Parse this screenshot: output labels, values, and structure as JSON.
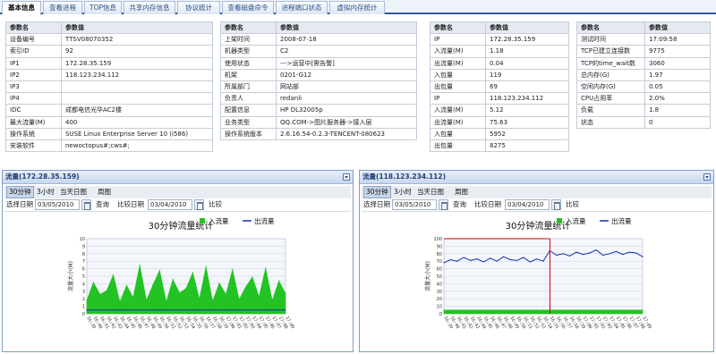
{
  "tabs": [
    {
      "label": "基本信息",
      "active": true
    },
    {
      "label": "查看进程"
    },
    {
      "label": "TOP信息"
    },
    {
      "label": "共享内存信息"
    },
    {
      "label": "协议统计"
    },
    {
      "label": "查看磁盘命令"
    },
    {
      "label": "进程端口状态"
    },
    {
      "label": "虚拟内存统计"
    }
  ],
  "table1": {
    "headers": [
      "参数名",
      "参数值"
    ],
    "rows": [
      [
        "设备编号",
        "TTSV08070352"
      ],
      [
        "索引ID",
        "92"
      ],
      [
        "IP1",
        "172.28.35.159"
      ],
      [
        "IP2",
        "118.123.234.112"
      ],
      [
        "IP3",
        ""
      ],
      [
        "IP4",
        ""
      ],
      [
        "IDC",
        "成都电信光华AC2楼"
      ],
      [
        "最大流量(M)",
        "400"
      ],
      [
        "操作系统",
        "SUSE Linux Enterprise Server 10 (i586)"
      ],
      [
        "安装软件",
        "newoctopus#;cws#;"
      ]
    ]
  },
  "table2": {
    "headers": [
      "参数名",
      "参数值"
    ],
    "rows": [
      [
        "上架时间",
        "2008-07-18"
      ],
      [
        "机器类型",
        "C2"
      ],
      [
        "使用状态",
        "--->运营中[需告警]"
      ],
      [
        "机架",
        "0201-G12"
      ],
      [
        "所属部门",
        "网站部"
      ],
      [
        "负责人",
        "redanli"
      ],
      [
        "配置信息",
        "HP DL32005p"
      ],
      [
        "业务类型",
        "QQ.COM->图片服务器->接入层"
      ],
      [
        "操作系统版本",
        "2.6.16.54-0.2.3-TENCENT-080623"
      ]
    ]
  },
  "table3": {
    "headers": [
      "参数名",
      "参数值"
    ],
    "rows": [
      [
        "IP",
        "172.28.35.159"
      ],
      [
        "入流量(M)",
        "1.18"
      ],
      [
        "出流量(M)",
        "0.04"
      ],
      [
        "入包量",
        "119"
      ],
      [
        "出包量",
        "69"
      ],
      [
        "IP",
        "118.123.234.112"
      ],
      [
        "入流量(M)",
        "5.12"
      ],
      [
        "出流量(M)",
        "75.63"
      ],
      [
        "入包量",
        "5952"
      ],
      [
        "出包量",
        "8275"
      ]
    ]
  },
  "table4": {
    "headers": [
      "参数名",
      "参数值"
    ],
    "rows": [
      [
        "测试时间",
        "17:09:58"
      ],
      [
        "TCP已建立连接数",
        "9775"
      ],
      [
        "TCP的time_wait数",
        "3060"
      ],
      [
        "总内存(G)",
        "1.97"
      ],
      [
        "空闲内存(G)",
        "0.05"
      ],
      [
        "CPU占用率",
        "2.0%"
      ],
      [
        "负载",
        "1.8"
      ],
      [
        "状态",
        "0"
      ]
    ]
  },
  "panels": [
    {
      "title": "流量(172.28.35.159)",
      "subtabs": [
        "30分钟",
        "3小时",
        "当天日图",
        "周图"
      ],
      "date_label": "选择日期",
      "date_value": "03/05/2010",
      "query_label": "查询",
      "compare_label": "比较日期",
      "compare_value": "03/04/2010",
      "compare_btn": "比较"
    },
    {
      "title": "流量(118.123.234.112)",
      "subtabs": [
        "30分钟",
        "3小时",
        "当天日图",
        "周图"
      ],
      "date_label": "选择日期",
      "date_value": "03/05/2010",
      "query_label": "查询",
      "compare_label": "比较日期",
      "compare_value": "03/04/2010",
      "compare_btn": "比较"
    }
  ],
  "colors": {
    "in_series": "#22c322",
    "out_series": "#1b2fa8",
    "accent": "#2c5a9b",
    "marker": "#cc0000"
  },
  "chart_data": [
    {
      "type": "area",
      "title": "30分钟流量统计",
      "ylabel": "流量大小(M)",
      "legend": [
        "入流量",
        "出流量"
      ],
      "legend_position": "top-right",
      "grid": true,
      "ylim": [
        0,
        10
      ],
      "x": [
        "16:39",
        "16:40",
        "16:41",
        "16:42",
        "16:43",
        "16:44",
        "16:45",
        "16:46",
        "16:47",
        "16:48",
        "16:49",
        "16:50",
        "16:51",
        "16:52",
        "16:53",
        "16:54",
        "16:55",
        "16:56",
        "16:57",
        "16:58",
        "16:59",
        "17:00",
        "17:01",
        "17:02",
        "17:03",
        "17:04",
        "17:05",
        "17:06",
        "17:07",
        "17:08",
        "17:09"
      ],
      "series": [
        {
          "name": "入流量",
          "values": [
            1.8,
            4.2,
            2.6,
            3.1,
            5.2,
            1.6,
            3.8,
            2.2,
            6.5,
            1.8,
            3.9,
            5.8,
            1.6,
            4.6,
            2.8,
            3.4,
            5.5,
            2.0,
            6.3,
            1.7,
            4.1,
            2.6,
            5.9,
            1.9,
            3.6,
            4.9,
            2.3,
            6.1,
            1.8,
            4.4,
            2.7
          ]
        },
        {
          "name": "出流量",
          "values": [
            0.5,
            0.5,
            0.5,
            0.5,
            0.5,
            0.5,
            0.5,
            0.5,
            0.5,
            0.5,
            0.5,
            0.5,
            0.5,
            0.5,
            0.5,
            0.5,
            0.5,
            0.5,
            0.5,
            0.5,
            0.5,
            0.5,
            0.5,
            0.5,
            0.5,
            0.5,
            0.5,
            0.5,
            0.5,
            0.5,
            0.5
          ]
        }
      ]
    },
    {
      "type": "line",
      "title": "30分钟流量统计",
      "ylabel": "流量大小(M)",
      "legend": [
        "入流量",
        "出流量"
      ],
      "legend_position": "top-right",
      "grid": true,
      "ylim": [
        0,
        100
      ],
      "yticks": [
        0,
        10,
        20,
        30,
        40,
        50,
        60,
        70,
        80,
        90,
        100
      ],
      "x": [
        "16:39",
        "16:40",
        "16:41",
        "16:42",
        "16:43",
        "16:44",
        "16:45",
        "16:46",
        "16:47",
        "16:48",
        "16:49",
        "16:50",
        "16:51",
        "16:52",
        "16:53",
        "16:54",
        "16:55",
        "16:56",
        "16:57",
        "16:58",
        "16:59",
        "17:00",
        "17:01",
        "17:02",
        "17:03",
        "17:04",
        "17:05",
        "17:06",
        "17:07",
        "17:08",
        "17:09"
      ],
      "marker_x": "16:55",
      "series": [
        {
          "name": "入流量",
          "values": [
            5,
            5,
            5,
            5,
            5,
            5,
            5,
            5,
            5,
            5,
            5,
            5,
            5,
            5,
            5,
            5,
            5,
            5,
            5,
            5,
            5,
            5,
            5,
            5,
            5,
            5,
            5,
            5,
            5,
            5,
            5
          ]
        },
        {
          "name": "出流量",
          "values": [
            68,
            72,
            70,
            75,
            71,
            73,
            69,
            74,
            70,
            76,
            72,
            71,
            75,
            69,
            73,
            70,
            84,
            78,
            80,
            77,
            82,
            79,
            81,
            85,
            78,
            80,
            83,
            79,
            82,
            81,
            76
          ]
        }
      ]
    }
  ]
}
